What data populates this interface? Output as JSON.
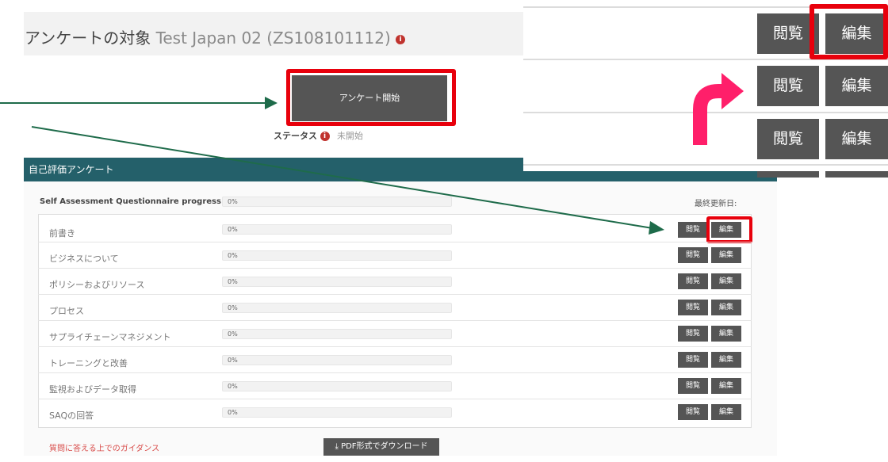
{
  "header": {
    "title": "アンケートの対象",
    "subtitle": "Test Japan 02 (ZS108101112)",
    "info_glyph": "i"
  },
  "start": {
    "button_label": "アンケート開始",
    "status_label": "ステータス",
    "status_value": "未開始"
  },
  "section": {
    "title": "自己評価アンケート",
    "progress_label": "Self Assessment Questionnaire progress",
    "progress_value": "0%",
    "last_updated_label": "最終更新日:",
    "rows": [
      {
        "label": "前書き",
        "progress": "0%",
        "view": "閲覧",
        "edit": "編集"
      },
      {
        "label": "ビジネスについて",
        "progress": "0%",
        "view": "閲覧",
        "edit": "編集"
      },
      {
        "label": "ポリシーおよびリソース",
        "progress": "0%",
        "view": "閲覧",
        "edit": "編集"
      },
      {
        "label": "プロセス",
        "progress": "0%",
        "view": "閲覧",
        "edit": "編集"
      },
      {
        "label": "サプライチェーンマネジメント",
        "progress": "0%",
        "view": "閲覧",
        "edit": "編集"
      },
      {
        "label": "トレーニングと改善",
        "progress": "0%",
        "view": "閲覧",
        "edit": "編集"
      },
      {
        "label": "監視およびデータ取得",
        "progress": "0%",
        "view": "閲覧",
        "edit": "編集"
      },
      {
        "label": "SAQの回答",
        "progress": "0%",
        "view": "閲覧",
        "edit": "編集"
      }
    ]
  },
  "footer": {
    "guidance_link": "質問に答える上でのガイダンス",
    "pdf_button": "PDF形式でダウンロード"
  },
  "zoom_inset": {
    "rows": [
      {
        "view": "閲覧",
        "edit": "編集"
      },
      {
        "view": "閲覧",
        "edit": "編集"
      },
      {
        "view": "閲覧",
        "edit": "編集"
      }
    ]
  },
  "colors": {
    "highlight": "#e8000c",
    "section_header": "#24606a",
    "arrow_green": "#1e6b4a",
    "arrow_pink": "#ff1f6a",
    "button": "#555555"
  }
}
